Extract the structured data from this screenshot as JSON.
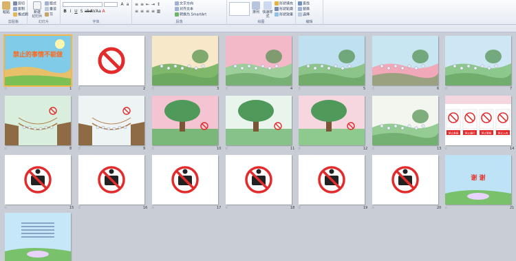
{
  "ribbon": {
    "clipboard": {
      "paste": "粘贴",
      "cut": "剪切",
      "copy": "复制",
      "format_painter": "格式刷",
      "label": "剪贴板"
    },
    "slides": {
      "new_slide": "新建\n幻灯片",
      "layout": "版式",
      "reset": "重设",
      "section": "节",
      "label": "幻灯片"
    },
    "font": {
      "label": "字体"
    },
    "paragraph": {
      "text_direction": "文字方向",
      "align_text": "对齐文本",
      "smartart": "转换为 SmartArt",
      "label": "段落"
    },
    "drawing": {
      "arrange": "排列",
      "quick_styles": "快速样式",
      "shape_fill": "形状填充",
      "shape_outline": "形状轮廓",
      "shape_effects": "形状效果",
      "label": "绘图"
    },
    "editing": {
      "find": "查找",
      "replace": "替换",
      "select": "选择",
      "label": "编辑"
    }
  },
  "slides": [
    {
      "num": "1",
      "kind": "title",
      "title_text": "禁止的事情不能做"
    },
    {
      "num": "2",
      "kind": "prohibit"
    },
    {
      "num": "3",
      "kind": "scene",
      "sky": "#f6e8c8",
      "ground": "#7fb86a"
    },
    {
      "num": "4",
      "kind": "scene",
      "sky": "#f4b9c9",
      "ground": "#9ccf9a"
    },
    {
      "num": "5",
      "kind": "scene",
      "sky": "#bfe0ef",
      "ground": "#8dc489"
    },
    {
      "num": "6",
      "kind": "scene",
      "sky": "#c8e5f2",
      "ground": "#f1a8b8"
    },
    {
      "num": "7",
      "kind": "scene",
      "sky": "#cde8f4",
      "ground": "#8cc88b"
    },
    {
      "num": "8",
      "kind": "bridge",
      "sky": "#d9eedc",
      "ground": "#9bc58a"
    },
    {
      "num": "9",
      "kind": "bridge",
      "sky": "#eef3f4",
      "ground": "#c9d6c3"
    },
    {
      "num": "10",
      "kind": "tree",
      "sky": "#f4c4d2",
      "ground": "#7ab879"
    },
    {
      "num": "11",
      "kind": "tree",
      "sky": "#e9f4ec",
      "ground": "#86c28a"
    },
    {
      "num": "12",
      "kind": "tree",
      "sky": "#f6d6df",
      "ground": "#8ec98d"
    },
    {
      "num": "13",
      "kind": "scene",
      "sky": "#f2f6ee",
      "ground": "#95cc94"
    },
    {
      "num": "14",
      "kind": "signs",
      "labels": [
        "禁止乘骑",
        "禁止通行",
        "禁止攀登",
        "禁止入内"
      ]
    },
    {
      "num": "15",
      "kind": "icon",
      "icon": "no-smoking-icon"
    },
    {
      "num": "16",
      "kind": "icon",
      "icon": "no-urinating-icon"
    },
    {
      "num": "17",
      "kind": "icon",
      "icon": "no-dogs-icon"
    },
    {
      "num": "18",
      "kind": "icon",
      "icon": "no-swimming-icon"
    },
    {
      "num": "19",
      "kind": "icon",
      "icon": "no-photography-icon"
    },
    {
      "num": "20",
      "kind": "icon",
      "icon": "no-fishing-icon"
    },
    {
      "num": "21",
      "kind": "thanks",
      "title_text": "谢 谢"
    },
    {
      "num": "22",
      "kind": "ending"
    }
  ],
  "colors": {
    "prohibit_red": "#e32b2b",
    "selection": "#f0b84a",
    "workspace": "#c9ced6"
  }
}
